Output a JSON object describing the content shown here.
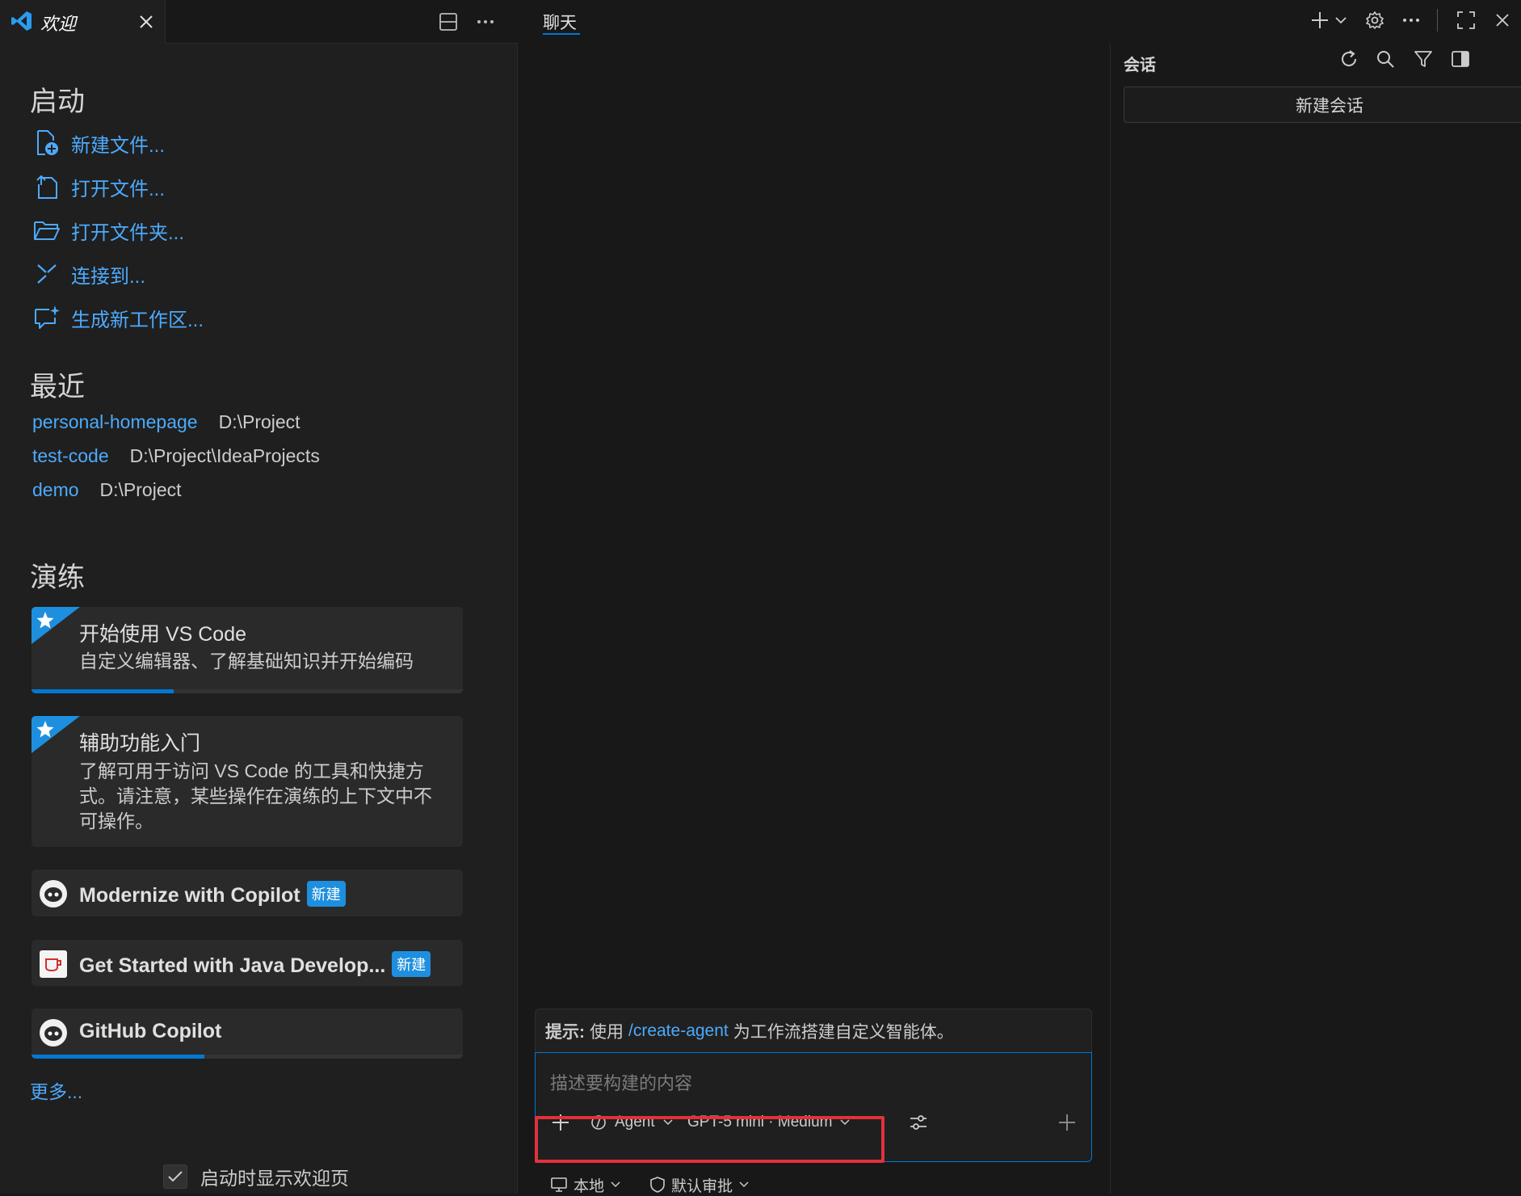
{
  "colors": {
    "accent": "#0078d4",
    "link": "#4daafc",
    "badge": "#1e8fde",
    "highlight": "#e0323c"
  },
  "left_tab": {
    "title": "欢迎",
    "icon": "vscode-logo",
    "close_icon": "close-icon"
  },
  "welcome": {
    "start": {
      "heading": "启动",
      "items": [
        {
          "label": "新建文件...",
          "icon": "new-file-icon"
        },
        {
          "label": "打开文件...",
          "icon": "open-file-icon"
        },
        {
          "label": "打开文件夹...",
          "icon": "folder-icon"
        },
        {
          "label": "连接到...",
          "icon": "remote-icon"
        },
        {
          "label": "生成新工作区...",
          "icon": "chat-sparkle-icon"
        }
      ]
    },
    "recent": {
      "heading": "最近",
      "items": [
        {
          "name": "personal-homepage",
          "path": "D:\\Project"
        },
        {
          "name": "test-code",
          "path": "D:\\Project\\IdeaProjects"
        },
        {
          "name": "demo",
          "path": "D:\\Project"
        }
      ]
    },
    "walkthroughs": {
      "heading": "演练",
      "cards": [
        {
          "title": "开始使用 VS Code",
          "desc": "自定义编辑器、了解基础知识并开始编码",
          "progress": 0.33
        },
        {
          "title": "辅助功能入门",
          "desc": "了解可用于访问 VS Code 的工具和快捷方式。请注意，某些操作在演练的上下文中不可操作。",
          "progress": 0
        },
        {
          "title": "Modernize with Copilot",
          "badge": "新建",
          "icon": "copilot-icon"
        },
        {
          "title": "Get Started with Java Develop...",
          "badge": "新建",
          "icon": "java-icon"
        },
        {
          "title": "GitHub Copilot",
          "icon": "copilot-icon",
          "progress": 0.4
        }
      ],
      "more": "更多..."
    },
    "show_on_startup": {
      "label": "启动时显示欢迎页",
      "checked": true
    }
  },
  "chat": {
    "tab": "聊天",
    "sessions": {
      "title": "会话",
      "new_button": "新建会话"
    },
    "tip": {
      "prefix": "提示:",
      "pre": "使用",
      "command": "/create-agent",
      "post": "为工作流搭建自定义智能体。"
    },
    "input_placeholder": "描述要构建的内容",
    "mode": "Agent",
    "model": "GPT-5 mini · Medium",
    "status": {
      "location": "本地",
      "approval": "默认审批"
    }
  }
}
